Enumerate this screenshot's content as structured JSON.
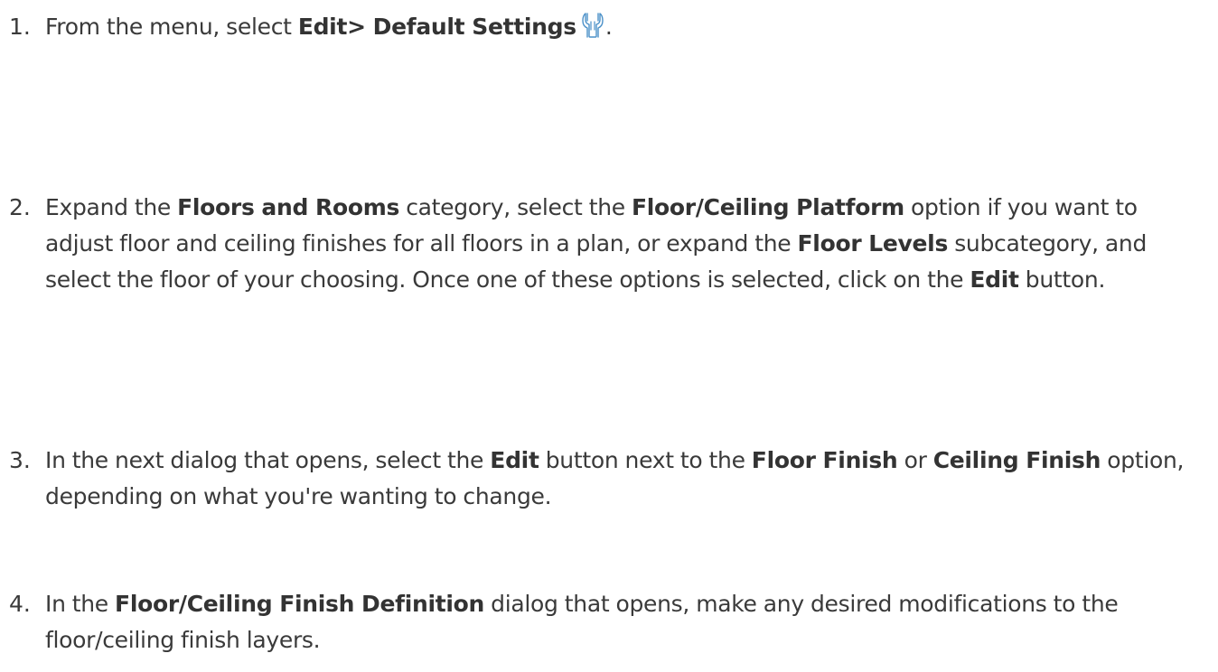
{
  "steps": [
    {
      "number": "1.",
      "parts": {
        "p1": "From the menu, select ",
        "b1": "Edit> Default Settings",
        "p2": "."
      },
      "icon": "wrench-icon"
    },
    {
      "number": "2.",
      "parts": {
        "p1": "Expand the ",
        "b1": "Floors and Rooms",
        "p2": " category, select the ",
        "b2": "Floor/Ceiling Platform",
        "p3": " option if you want to adjust floor and ceiling finishes for all floors in a plan, or expand the ",
        "b3": "Floor Levels",
        "p4": " subcategory, and select the floor of your choosing. Once one of these options is selected, click on the ",
        "b4": "Edit",
        "p5": " button."
      }
    },
    {
      "number": "3.",
      "parts": {
        "p1": "In the next dialog that opens, select the ",
        "b1": "Edit",
        "p2": " button next to the ",
        "b2": "Floor Finish",
        "p3": " or ",
        "b3": "Ceiling Finish",
        "p4": " option, depending on what you're wanting to change."
      }
    },
    {
      "number": "4.",
      "parts": {
        "p1": "In the ",
        "b1": "Floor/Ceiling Finish Definition",
        "p2": " dialog that opens, make any desired modifications to the floor/ceiling finish layers."
      }
    }
  ],
  "colors": {
    "text": "#3a3a3a",
    "icon": "#4a90c8"
  }
}
